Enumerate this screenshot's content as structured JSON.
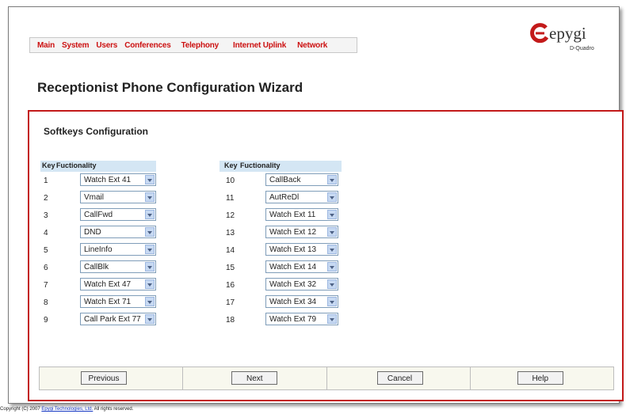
{
  "nav": {
    "items": [
      "Main",
      "System",
      "Users",
      "Conferences",
      "Telephony",
      "Internet Uplink",
      "Network"
    ]
  },
  "logo": {
    "brand": "epygi",
    "model": "D-Quadro"
  },
  "page_title": "Receptionist Phone Configuration Wizard",
  "section_title": "Softkeys Configuration",
  "table_headers": {
    "key": "Key",
    "functionality": "Fuctionality"
  },
  "left_rows": [
    {
      "key": "1",
      "value": "Watch Ext 41"
    },
    {
      "key": "2",
      "value": "Vmail"
    },
    {
      "key": "3",
      "value": "CallFwd"
    },
    {
      "key": "4",
      "value": "DND"
    },
    {
      "key": "5",
      "value": "LineInfo"
    },
    {
      "key": "6",
      "value": "CallBlk"
    },
    {
      "key": "7",
      "value": "Watch Ext 47"
    },
    {
      "key": "8",
      "value": "Watch Ext 71"
    },
    {
      "key": "9",
      "value": "Call Park Ext 77"
    }
  ],
  "right_rows": [
    {
      "key": "10",
      "value": "CallBack"
    },
    {
      "key": "11",
      "value": "AutReDl"
    },
    {
      "key": "12",
      "value": "Watch Ext 11"
    },
    {
      "key": "13",
      "value": "Watch Ext 12"
    },
    {
      "key": "14",
      "value": "Watch Ext 13"
    },
    {
      "key": "15",
      "value": "Watch Ext 14"
    },
    {
      "key": "16",
      "value": "Watch Ext 32"
    },
    {
      "key": "17",
      "value": "Watch Ext 34"
    },
    {
      "key": "18",
      "value": "Watch Ext 79"
    }
  ],
  "buttons": {
    "previous": "Previous",
    "next": "Next",
    "cancel": "Cancel",
    "help": "Help"
  },
  "footer": {
    "prefix": "Copyright (C) 2007 ",
    "link": "Epygi Technologies, Ltd.",
    "suffix": " All rights reserved."
  },
  "colors": {
    "accent": "#c31a1a",
    "nav_text": "#cc1111",
    "header_bg": "#d4e6f4"
  }
}
